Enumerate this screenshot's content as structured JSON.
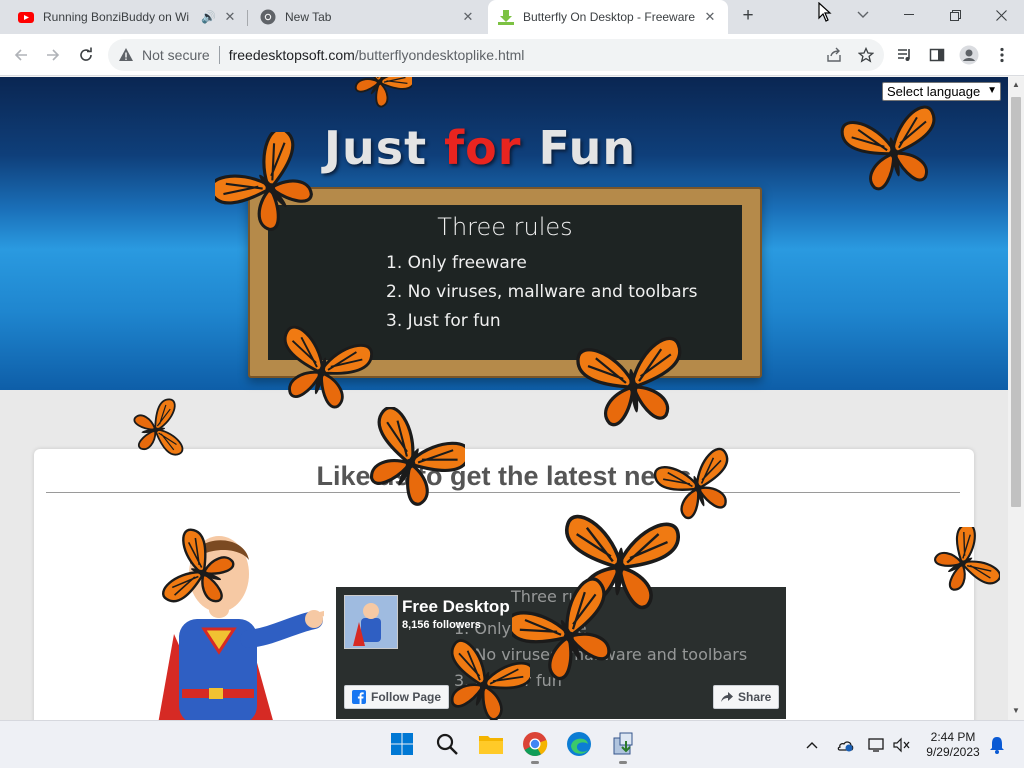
{
  "browser": {
    "tabs": [
      {
        "title": "Running BonziBuddy on Wi",
        "favicon": "youtube-icon"
      },
      {
        "title": "New Tab",
        "favicon": "chrome-icon"
      },
      {
        "title": "Butterfly On Desktop - Freeware",
        "favicon": "download-arrow-icon",
        "active": true
      }
    ],
    "address": {
      "security_label": "Not secure",
      "domain": "freedesktopsoft.com",
      "path": "/butterflyondesktoplike.html"
    }
  },
  "page": {
    "language_select": "Select language",
    "hero": {
      "title_a": "Just ",
      "title_b": "for",
      "title_c": " Fun"
    },
    "board": {
      "title": "Three rules",
      "rules": [
        "1. Only freeware",
        "2. No viruses, mallware and toolbars",
        "3. Just for fun"
      ]
    },
    "card_title": "Like us to get the latest news",
    "fb": {
      "page_name": "Free Desktop",
      "followers": "8,156 followers",
      "follow_label": "Follow Page",
      "share_label": "Share",
      "ghost_lines": [
        "Three rules",
        "1. Only freeware",
        "2. No viruses, mallware and toolbars",
        "3. Just for fun"
      ]
    }
  },
  "taskbar": {
    "time": "2:44 PM",
    "date": "9/29/2023",
    "apps": [
      "windows-start-icon",
      "search-icon",
      "file-explorer-icon",
      "chrome-icon",
      "edge-icon",
      "installer-icon"
    ]
  },
  "colors": {
    "accent_red": "#e8241f",
    "hero_blue": "#1a6fb8",
    "chalkboard": "#1e2423",
    "butterfly_orange": "#f07a12"
  }
}
